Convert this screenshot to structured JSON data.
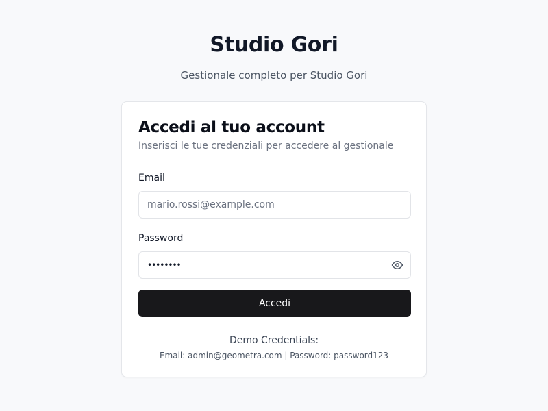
{
  "header": {
    "title": "Studio Gori",
    "subtitle": "Gestionale completo per Studio Gori"
  },
  "card": {
    "title": "Accedi al tuo account",
    "description": "Inserisci le tue credenziali per accedere al gestionale"
  },
  "form": {
    "email": {
      "label": "Email",
      "placeholder": "mario.rossi@example.com",
      "value": ""
    },
    "password": {
      "label": "Password",
      "value": "••••••••",
      "toggle_icon": "eye-icon"
    },
    "submit_label": "Accedi"
  },
  "demo": {
    "title": "Demo Credentials:",
    "detail": "Email: admin@geometra.com | Password: password123"
  },
  "colors": {
    "background": "#f8f9fb",
    "card": "#ffffff",
    "button": "#18181b",
    "border": "#e2e4e8"
  }
}
